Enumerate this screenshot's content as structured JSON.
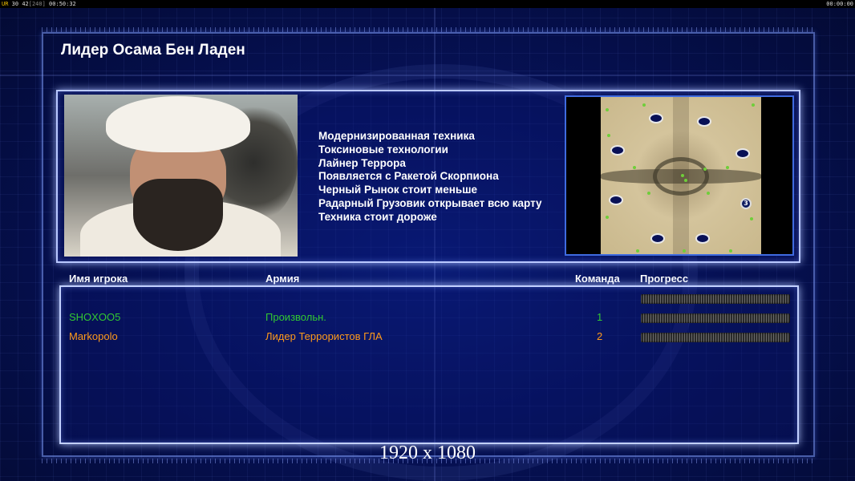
{
  "topbar": {
    "left_tag": "UR",
    "left_fps": "30",
    "left_val": "42",
    "left_bracket": "[240]",
    "left_time": "00:50:32",
    "right_time": "00:00:00"
  },
  "title": "Лидер Осама Бен Ладен",
  "features": [
    "Модернизированная техника",
    "Токсиновые технологии",
    "Лайнер Террора",
    "Появляется с Ракетой Скорпиона",
    "Черный Рынок стоит меньше",
    "Радарный Грузовик открывает всю карту",
    "Техника стоит дороже"
  ],
  "map": {
    "start_label": "3"
  },
  "table": {
    "headers": {
      "player": "Имя игрока",
      "army": "Армия",
      "team": "Команда",
      "progress": "Прогресс"
    },
    "rows": [
      {
        "player": "",
        "army": "",
        "team": "",
        "color": "#2a3a9a",
        "progress": 0
      },
      {
        "player": "SHOXOO5",
        "army": "Произвольн.",
        "team": "1",
        "color": "#32c832",
        "progress": 0
      },
      {
        "player": "Markopolo",
        "army": "Лидер Террористов ГЛА",
        "team": "2",
        "color": "#ff9a1a",
        "progress": 0
      }
    ]
  },
  "resolution": "1920 x 1080"
}
